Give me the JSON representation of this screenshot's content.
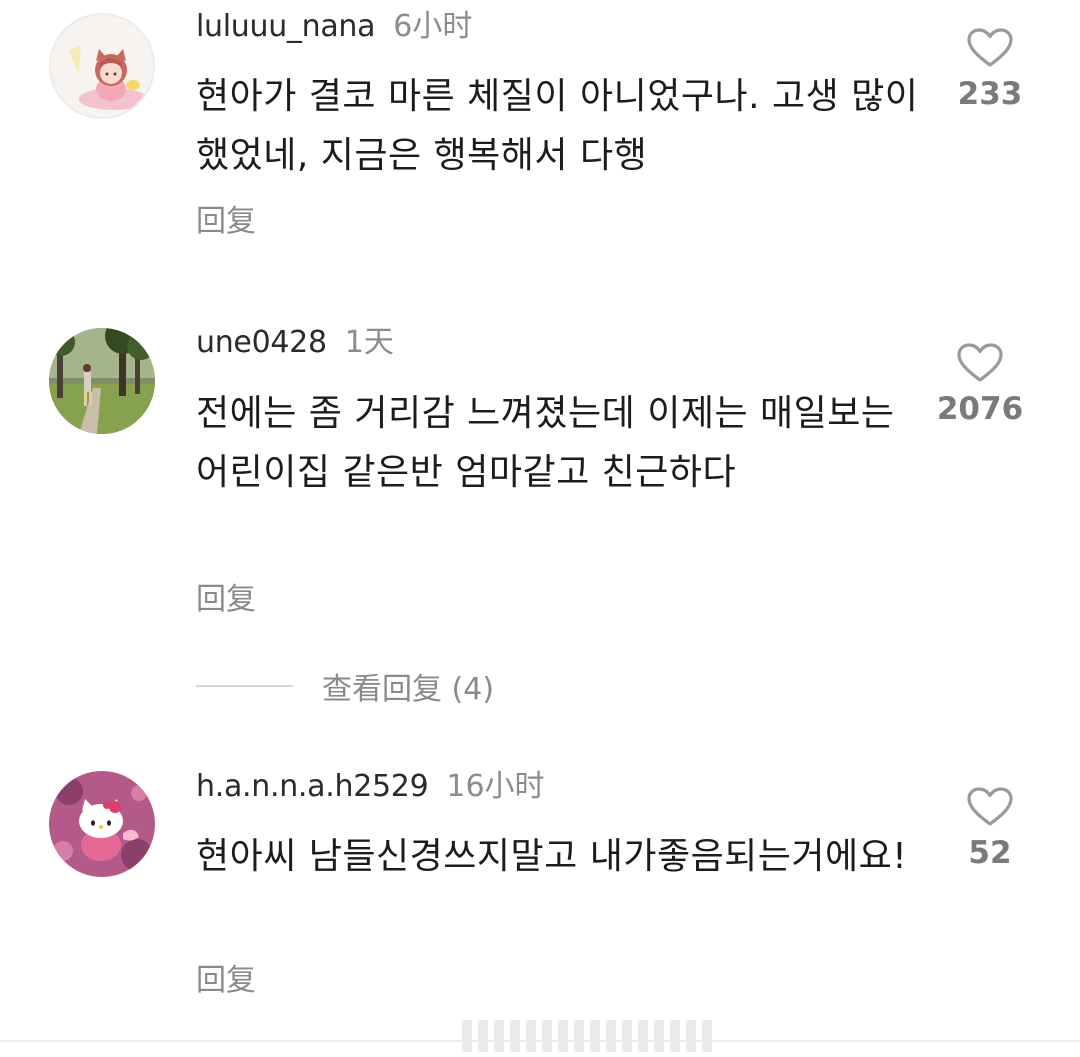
{
  "comments": [
    {
      "username": "luluuu_nana",
      "time": "6小时",
      "text": "현아가 결코 마른 체질이 아니었구나. 고생 많이 했었네, 지금은 행복해서 다행",
      "likes": "233",
      "reply_label": "回复",
      "avatar": "anime-girl-avatar"
    },
    {
      "username": "une0428",
      "time": "1天",
      "text": "전에는 좀 거리감 느껴졌는데 이제는 매일보는 어린이집 같은반 엄마같고 친근하다",
      "likes": "2076",
      "reply_label": "回复",
      "view_replies": "查看回复 (4)",
      "avatar": "park-photo-avatar"
    },
    {
      "username": "h.a.n.n.a.h2529",
      "time": "16小时",
      "text": "현아씨 남들신경쓰지말고 내가좋음되는거에요!",
      "likes": "52",
      "reply_label": "回复",
      "avatar": "hello-kitty-avatar"
    }
  ],
  "icons": {
    "like": "heart-outline-icon"
  },
  "colors": {
    "text": "#1c1c1c",
    "muted": "#8a8a8a",
    "like_count": "#7a7a7a",
    "background": "#ffffff"
  }
}
